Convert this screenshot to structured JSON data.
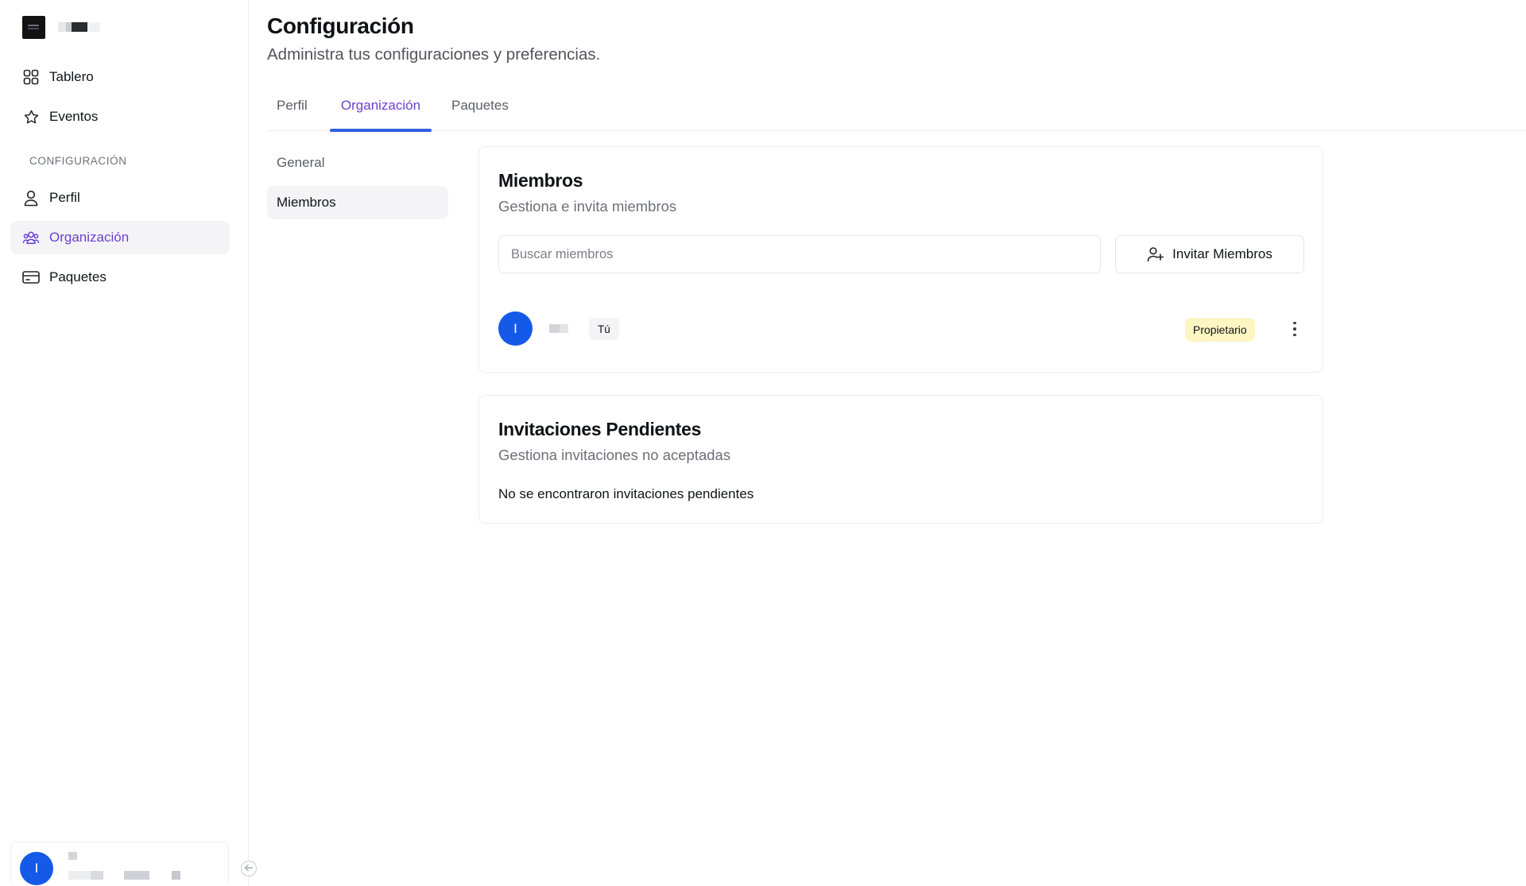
{
  "sidebar": {
    "nav": [
      {
        "label": "Tablero",
        "icon": "grid-icon"
      },
      {
        "label": "Eventos",
        "icon": "star-icon"
      }
    ],
    "section_label": "CONFIGURACIÓN",
    "settings_nav": [
      {
        "label": "Perfil",
        "icon": "user-icon",
        "active": false
      },
      {
        "label": "Organización",
        "icon": "users-icon",
        "active": true
      },
      {
        "label": "Paquetes",
        "icon": "credit-card-icon",
        "active": false
      }
    ],
    "user": {
      "avatar_initial": "I"
    }
  },
  "header": {
    "title": "Configuración",
    "subtitle": "Administra tus configuraciones y preferencias."
  },
  "tabs": [
    {
      "label": "Perfil",
      "active": false
    },
    {
      "label": "Organización",
      "active": true
    },
    {
      "label": "Paquetes",
      "active": false
    }
  ],
  "subnav": [
    {
      "label": "General",
      "active": false
    },
    {
      "label": "Miembros",
      "active": true
    }
  ],
  "members_card": {
    "title": "Miembros",
    "description": "Gestiona e invita miembros",
    "search_placeholder": "Buscar miembros",
    "invite_label": "Invitar Miembros",
    "members": [
      {
        "avatar_initial": "I",
        "you_label": "Tú",
        "role": "Propietario"
      }
    ]
  },
  "invitations_card": {
    "title": "Invitaciones Pendientes",
    "description": "Gestiona invitaciones no aceptadas",
    "empty_text": "No se encontraron invitaciones pendientes"
  },
  "colors": {
    "accent": "#6c3fd1",
    "tab_indicator": "#2f5fe0",
    "avatar": "#1559e8",
    "owner_badge": "#fdf6c3"
  }
}
